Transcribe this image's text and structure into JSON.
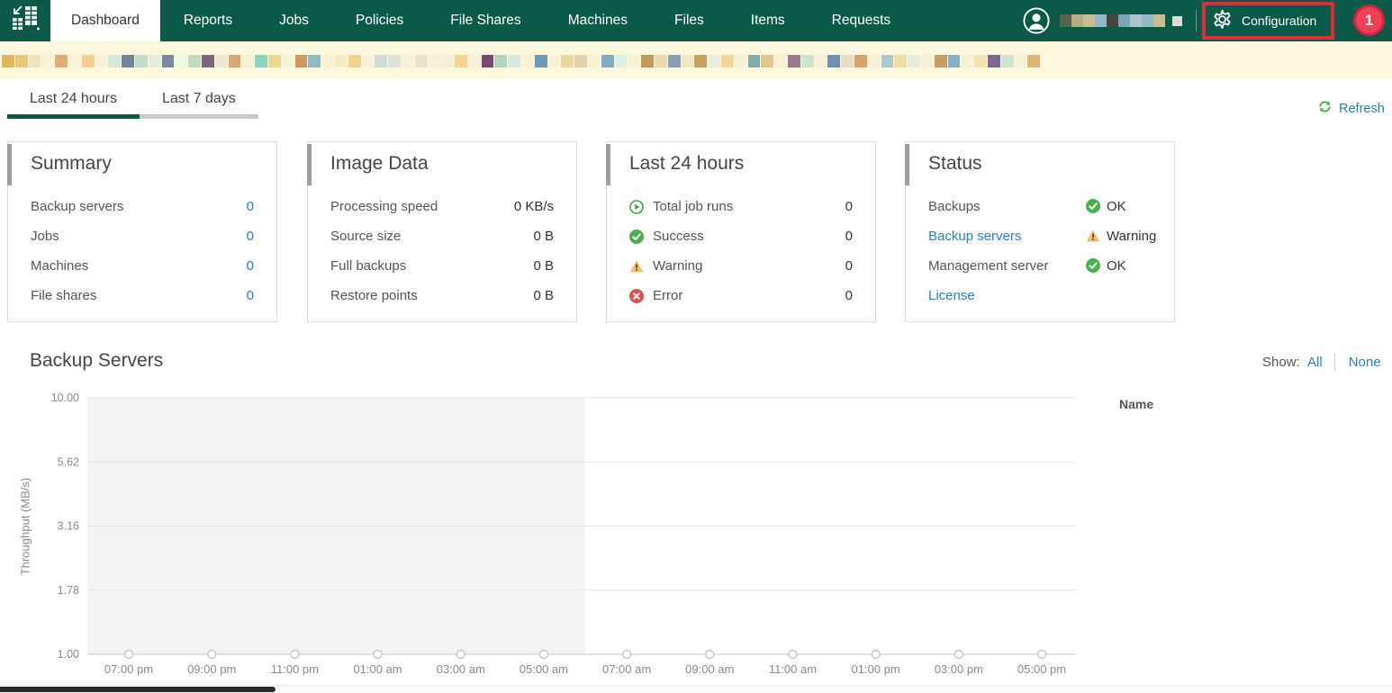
{
  "nav": {
    "tabs": [
      {
        "label": "Dashboard",
        "active": true
      },
      {
        "label": "Reports"
      },
      {
        "label": "Jobs"
      },
      {
        "label": "Policies"
      },
      {
        "label": "File Shares"
      },
      {
        "label": "Machines"
      },
      {
        "label": "Files"
      },
      {
        "label": "Items"
      },
      {
        "label": "Requests"
      }
    ],
    "configuration_label": "Configuration",
    "notification_badge": "1",
    "user_redacted_blocks": [
      "#59624f",
      "#b9ab80",
      "#c8bd92",
      "#8fb8c8",
      "#45453e",
      "#7ba6b8",
      "#a9c6d0",
      "#93b9c9",
      "#c9bd94"
    ],
    "colors": {
      "nav_green": "#0b5a47",
      "badge_red": "#ef4056",
      "annotation_red": "#e4293d"
    }
  },
  "redacted_strip": {
    "background": "#fcf8dd",
    "blocks": [
      "#e2b85c",
      "#e9c976",
      "#efe3c0",
      "#f7f1d6",
      "#e2ad74",
      "#f8f2d8",
      "#f2cd8e",
      "#f7f1d6",
      "#d9e6da",
      "#75839d",
      "#c4dccd",
      "#e3eedf",
      "#7b89a4",
      "#edf9de",
      "#c2dac2",
      "#7d6580",
      "#efe7d2",
      "#d7a873",
      "#f7f1d6",
      "#8ed3bc",
      "#e9d88e",
      "#f7f1d6",
      "#ce9962",
      "#92bbc5",
      "#f7f1d6",
      "#f5ecc4",
      "#f2d38b",
      "#f7f1d6",
      "#d2dbd6",
      "#dce3d9",
      "#f7f1d6",
      "#e8e2ce",
      "#f7f1d6",
      "#f6f0d5",
      "#f5d293",
      "#f7f1d6",
      "#794a6d",
      "#b3d5bc",
      "#d8e7db",
      "#f7f1d6",
      "#6e99b4",
      "#f7f1d6",
      "#edd8a1",
      "#e3d2ac",
      "#f7f1d6",
      "#80adbd",
      "#deefe1",
      "#f7f1d6",
      "#c0995d",
      "#ead9b0",
      "#8a9fb4",
      "#efe5c7",
      "#c89f5d",
      "#e7efdf",
      "#f1d699",
      "#f7f1d6",
      "#7eafa7",
      "#dfc889",
      "#f7f1d6",
      "#9b7991",
      "#cee4d1",
      "#f7f1d6",
      "#6e91ad",
      "#e9debf",
      "#d8a169",
      "#f7f1d6",
      "#a9cad3",
      "#efdfa7",
      "#e5eedc",
      "#f7f1d6",
      "#c69b65",
      "#87b1c1",
      "#f7f1d6",
      "#f3e1b1",
      "#7c698d",
      "#d1e3d3",
      "#f7f1d6",
      "#e1b476"
    ]
  },
  "view_tabs": {
    "active": "Last 24 hours",
    "inactive": "Last 7 days"
  },
  "refresh": {
    "label": "Refresh"
  },
  "cards": {
    "summary": {
      "title": "Summary",
      "rows": [
        {
          "label": "Backup servers",
          "value": "0"
        },
        {
          "label": "Jobs",
          "value": "0"
        },
        {
          "label": "Machines",
          "value": "0"
        },
        {
          "label": "File shares",
          "value": "0"
        }
      ]
    },
    "image_data": {
      "title": "Image Data",
      "rows": [
        {
          "label": "Processing speed",
          "value": "0 KB/s"
        },
        {
          "label": "Source size",
          "value": "0 B"
        },
        {
          "label": "Full backups",
          "value": "0 B"
        },
        {
          "label": "Restore points",
          "value": "0 B"
        }
      ]
    },
    "last_24_hours": {
      "title": "Last 24 hours",
      "rows": [
        {
          "icon": "play",
          "label": "Total job runs",
          "value": "0"
        },
        {
          "icon": "success",
          "label": "Success",
          "value": "0"
        },
        {
          "icon": "warning",
          "label": "Warning",
          "value": "0"
        },
        {
          "icon": "error",
          "label": "Error",
          "value": "0"
        }
      ]
    },
    "status": {
      "title": "Status",
      "rows": [
        {
          "label": "Backups",
          "link": false,
          "status_icon": "ok",
          "status": "OK"
        },
        {
          "label": "Backup servers",
          "link": true,
          "status_icon": "warning",
          "status": "Warning"
        },
        {
          "label": "Management server",
          "link": false,
          "status_icon": "ok",
          "status": "OK"
        },
        {
          "label": "License",
          "link": true,
          "status_icon": "",
          "status": ""
        }
      ]
    }
  },
  "backup_servers_section": {
    "title": "Backup Servers",
    "show_label": "Show:",
    "all_label": "All",
    "none_label": "None",
    "name_column_header": "Name"
  },
  "chart_data": {
    "type": "line",
    "title": "Backup Servers",
    "xlabel": "",
    "ylabel": "Throughput (MB/s)",
    "y_scale": "log",
    "ylim": [
      1,
      10
    ],
    "y_ticks": [
      "10.00",
      "5.62",
      "3.16",
      "1.78",
      "1.00"
    ],
    "x_ticks": [
      "07:00 pm",
      "09:00 pm",
      "11:00 pm",
      "01:00 am",
      "03:00 am",
      "05:00 am",
      "07:00 am",
      "09:00 am",
      "11:00 am",
      "01:00 pm",
      "03:00 pm",
      "05:00 pm"
    ],
    "series": [],
    "grid": true,
    "shaded_region": {
      "from_left_edge": true,
      "ends_at": "06:00 am",
      "color": "#f3f3f3"
    }
  }
}
